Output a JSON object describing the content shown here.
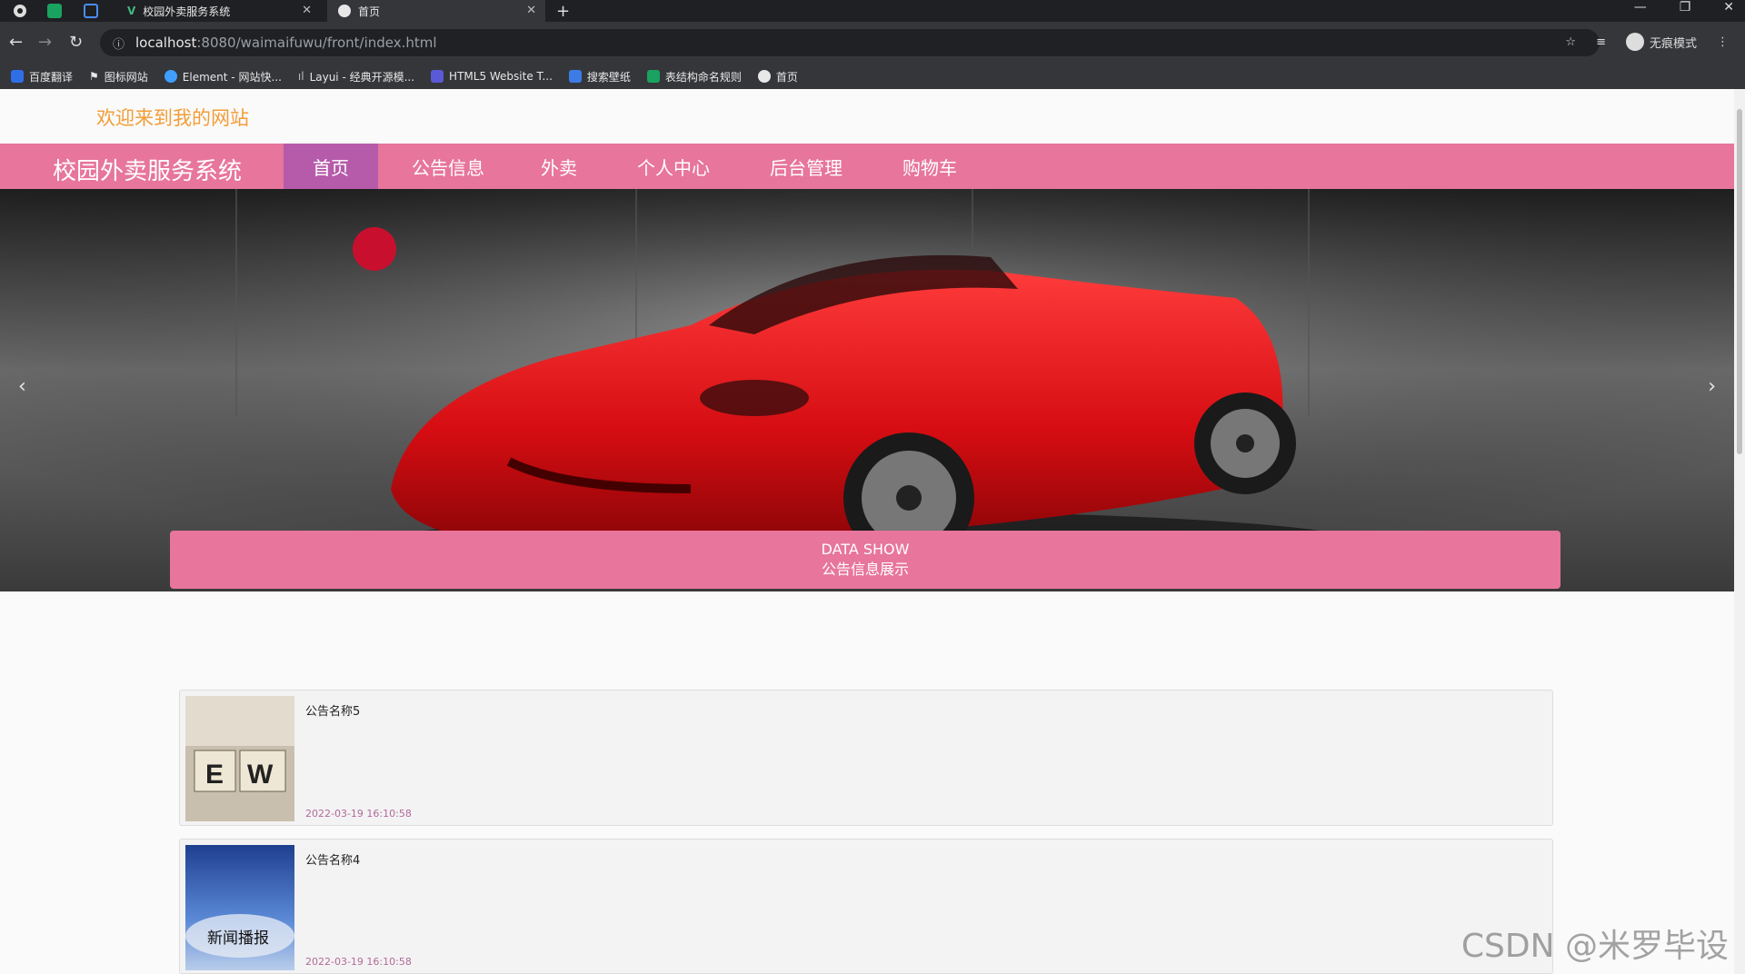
{
  "browser": {
    "tabs": [
      {
        "title": "校园外卖服务系统"
      },
      {
        "title": "首页"
      }
    ],
    "url_host": "localhost",
    "url_path": ":8080/waimaifuwu/front/index.html",
    "profile_label": "无痕模式",
    "bookmarks": [
      {
        "label": "百度翻译",
        "color": "#2f6fe6"
      },
      {
        "label": "图标网站",
        "color": "#ffffff"
      },
      {
        "label": "Element - 网站快...",
        "color": "#409eff"
      },
      {
        "label": "Layui - 经典开源模...",
        "color": "#999999"
      },
      {
        "label": "HTML5 Website T...",
        "color": "#5a5ad6"
      },
      {
        "label": "搜索壁纸",
        "color": "#3d7be6"
      },
      {
        "label": "表结构命名规则",
        "color": "#1aa260"
      },
      {
        "label": "首页",
        "color": "#ffffff"
      }
    ]
  },
  "site": {
    "welcome": "欢迎来到我的网站",
    "brand": "校园外卖服务系统",
    "nav": [
      {
        "label": "首页",
        "active": true
      },
      {
        "label": "公告信息",
        "active": false
      },
      {
        "label": "外卖",
        "active": false
      },
      {
        "label": "个人中心",
        "active": false
      },
      {
        "label": "后台管理",
        "active": false
      },
      {
        "label": "购物车",
        "active": false
      }
    ],
    "carousel": {
      "slide_count": 3,
      "active_index": 0
    },
    "section": {
      "title_en": "DATA SHOW",
      "title_cn": "公告信息展示"
    },
    "news": [
      {
        "title": "公告名称5",
        "time": "2022-03-19 16:10:58",
        "thumb_text": "E W"
      },
      {
        "title": "公告名称4",
        "time": "2022-03-19 16:10:58",
        "thumb_text": "新闻播报"
      }
    ]
  },
  "watermark": "CSDN @米罗毕设",
  "colors": {
    "accent_pink": "#e7759c",
    "nav_active": "#b65baa",
    "welcome_orange": "#f29d38"
  }
}
